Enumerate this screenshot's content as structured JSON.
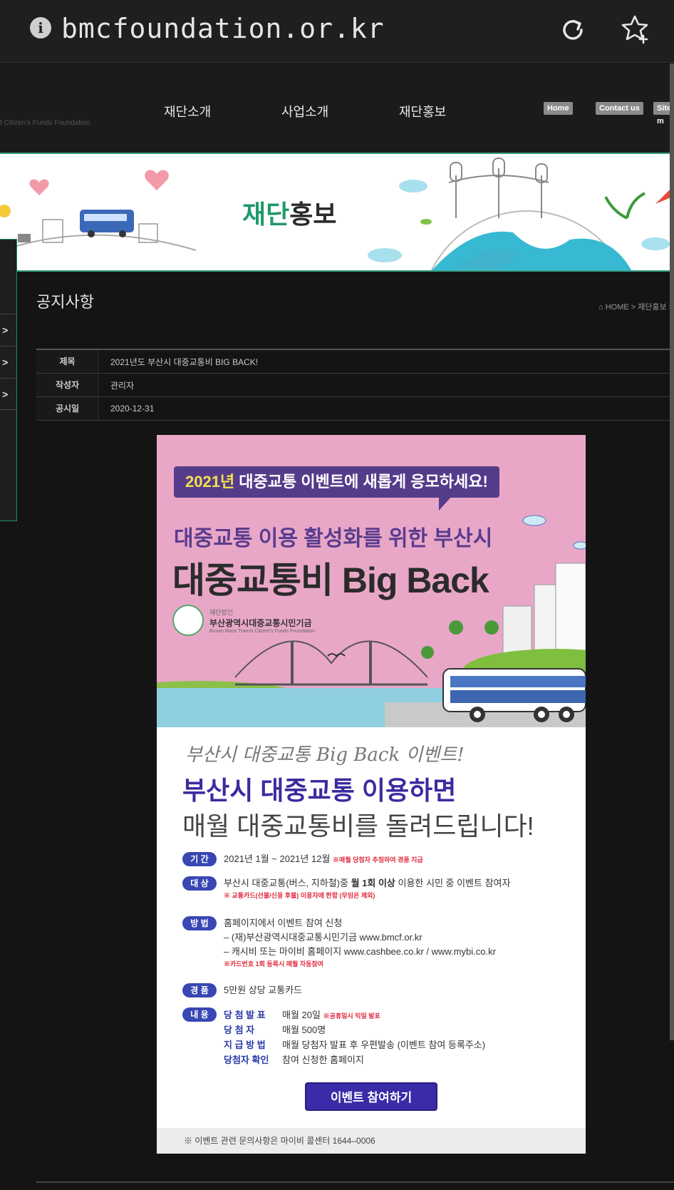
{
  "browser": {
    "url": "bmcfoundation.or.kr",
    "info_icon": "info-icon",
    "reload_icon": "reload-icon",
    "bookmark_icon": "star-add-icon"
  },
  "header": {
    "brand_sub": "t Citizen's Funds Foundation",
    "nav": [
      "재단소개",
      "사업소개",
      "재단홍보"
    ],
    "util": [
      "Home",
      "Contact us",
      "Site m"
    ]
  },
  "banner": {
    "title_green": "재단",
    "title_dark": "홍보"
  },
  "left_panel": {
    "arrows": [
      ">",
      ">",
      ">"
    ]
  },
  "section": {
    "title": "공지사항",
    "breadcrumb": "⌂ HOME > 재단홍보 >"
  },
  "notice_meta": [
    {
      "key": "제목",
      "value": "2021년도 부산시 대중교통비 BIG BACK!"
    },
    {
      "key": "작성자",
      "value": "관리자"
    },
    {
      "key": "공시일",
      "value": "2020-12-31"
    }
  ],
  "poster": {
    "bubble_year": "2021년",
    "bubble_text": " 대중교통 이벤트에 새롭게 응모하세요!",
    "sub_title": "대중교통 이용 활성화를 위한 부산시",
    "main_title": "대중교통비 Big Back",
    "org_t1": "재단법인",
    "org_t2": "부산광역시대중교통시민기금",
    "org_t3": "Busan Mass Transit Citizen's Funds Foundation",
    "handwritten": "부산시 대중교통 Big Back 이벤트!",
    "headline1": "부산시 대중교통 이용하면",
    "headline2": "매월 대중교통비를 돌려드립니다!",
    "items": {
      "period_badge": "기 간",
      "period_text": "2021년 1월 ~ 2021년 12월",
      "period_note": "※매월 당첨자 추첨하여 경품 지급",
      "target_badge": "대 상",
      "target_pre": "부산시 대중교통(버스, 지하철)중 ",
      "target_bold": "월 1회 이상",
      "target_post": " 이용한 시민 중 이벤트 참여자",
      "target_note": "※ 교통카드(선불/신용 후불) 이용자에 한함 (무임은 제외)",
      "method_badge": "방 법",
      "method_l1": "홈페이지에서 이벤트 참여 신청",
      "method_l2": "– (재)부산광역시대중교통시민기금  www.bmcf.or.kr",
      "method_l3": "– 캐시비 또는 마이비 홈페이지  www.cashbee.co.kr / www.mybi.co.kr",
      "method_note": "※카드번호 1회 등록시 매월 자동참여",
      "prize_badge": "경 품",
      "prize_text": "5만원 상당 교통카드",
      "content_badge": "내 용",
      "c1_label": "당 첨 발 표",
      "c1_text": "매월 20일",
      "c1_note": "※공휴일시 익일 발표",
      "c2_label": "당   첨   자",
      "c2_text": "매월 500명",
      "c3_label": "지 급 방 법",
      "c3_text": "매월 당첨자 발표 후 우편발송 (이벤트 참여 등록주소)",
      "c4_label": "당첨자 확인",
      "c4_text": "참여 신청한 홈페이지"
    },
    "cta": "이벤트 참여하기",
    "footer": "※ 이벤트 관련 문의사항은 마이비 콜센터 1644–0006"
  }
}
